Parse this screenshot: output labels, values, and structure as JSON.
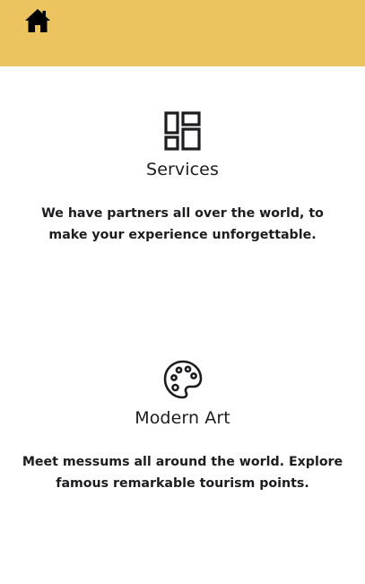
{
  "header": {
    "background_color": "#ebc35f",
    "home_icon": "home-icon"
  },
  "features": [
    {
      "icon": "layout-grid-icon",
      "title": "Services",
      "text": "We have partners all over the world, to make your experience unforgettable."
    },
    {
      "icon": "palette-icon",
      "title": "Modern Art",
      "text": "Meet messums all around the world. Explore famous remarkable tourism points."
    }
  ]
}
